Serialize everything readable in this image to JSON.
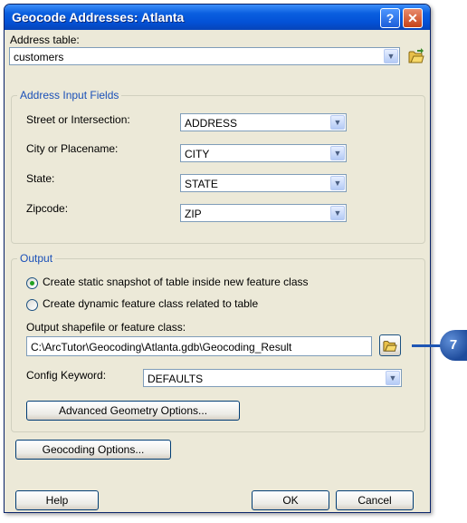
{
  "window": {
    "title": "Geocode Addresses:  Atlanta",
    "help_glyph": "?",
    "close_glyph": "✕"
  },
  "address_table": {
    "label": "Address table:",
    "value": "customers"
  },
  "address_input": {
    "legend": "Address Input Fields",
    "fields": [
      {
        "label": "Street or Intersection:",
        "value": "ADDRESS"
      },
      {
        "label": "City or Placename:",
        "value": "CITY"
      },
      {
        "label": "State:",
        "value": "STATE"
      },
      {
        "label": "Zipcode:",
        "value": "ZIP"
      }
    ]
  },
  "output": {
    "legend": "Output",
    "radio_static": "Create static snapshot of table inside new feature class",
    "radio_dynamic": "Create dynamic feature class related to table",
    "selected": "static",
    "shapefile_label": "Output shapefile or feature class:",
    "shapefile_value": "C:\\ArcTutor\\Geocoding\\Atlanta.gdb\\Geocoding_Result",
    "config_label": "Config Keyword:",
    "config_value": "DEFAULTS",
    "advanced_button": "Advanced Geometry Options..."
  },
  "buttons": {
    "geocoding_options": "Geocoding Options...",
    "help": "Help",
    "ok": "OK",
    "cancel": "Cancel"
  },
  "callout": {
    "number": "7"
  },
  "colors": {
    "titlebar": "#0a5fe0",
    "dialog_bg": "#ece9d8",
    "legend_text": "#1a50b8",
    "callout": "#1e56b4"
  }
}
